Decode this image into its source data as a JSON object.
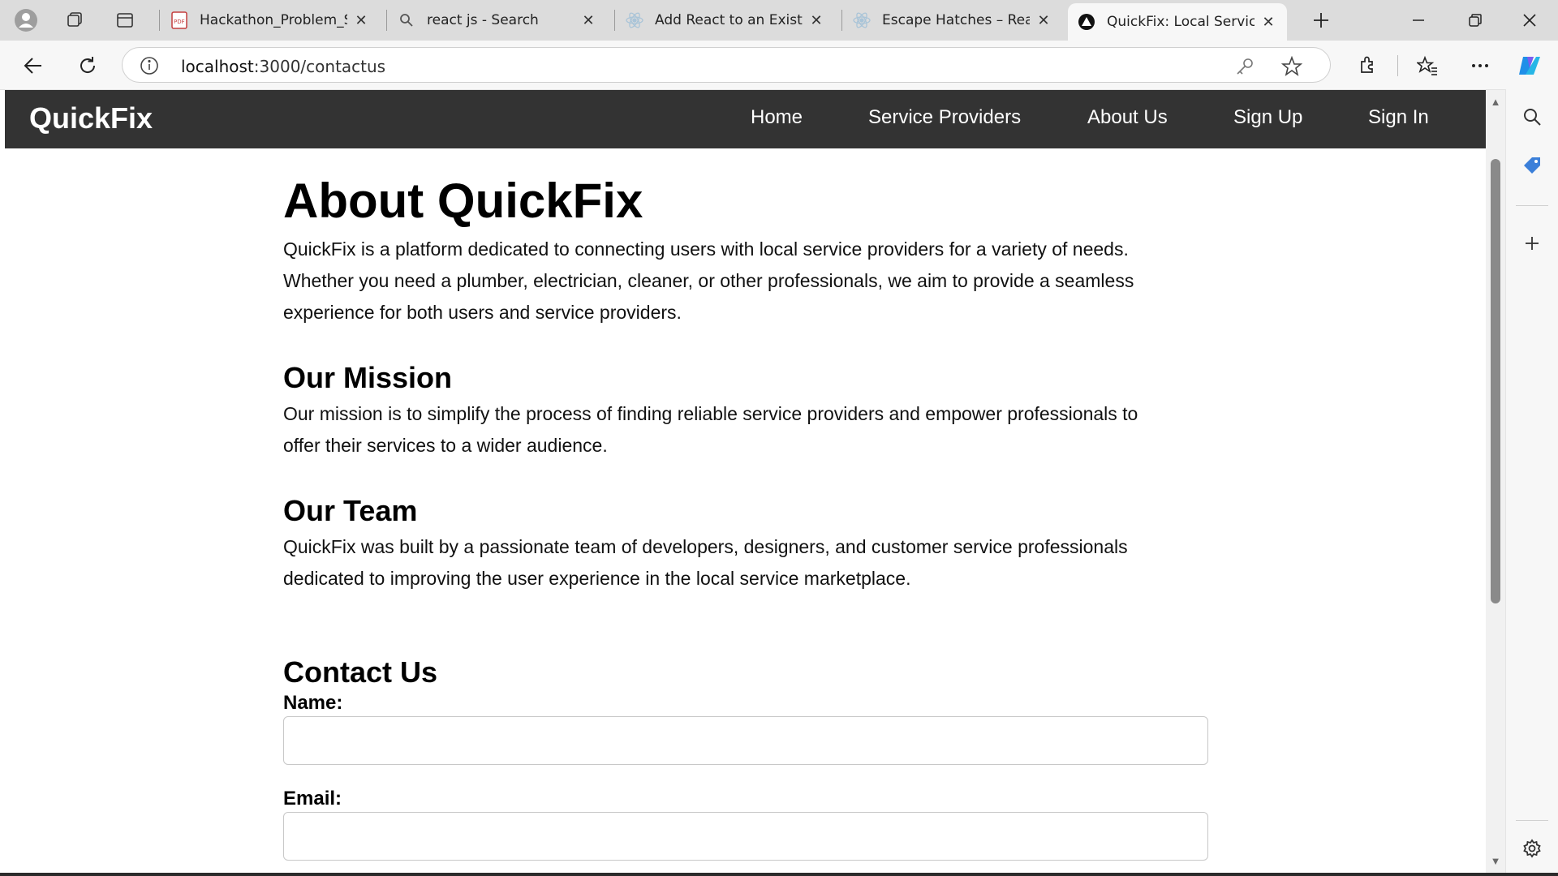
{
  "browser": {
    "tabs": [
      {
        "label": "Hackathon_Problem_Sta",
        "favicon": "pdf-icon"
      },
      {
        "label": "react js - Search",
        "favicon": "search-icon"
      },
      {
        "label": "Add React to an Existing",
        "favicon": "react-icon"
      },
      {
        "label": "Escape Hatches – React",
        "favicon": "react-icon"
      },
      {
        "label": "QuickFix: Local Service P",
        "favicon": "app-icon",
        "active": true
      }
    ],
    "url_host": "localhost",
    "url_rest": ":3000/contactus"
  },
  "app": {
    "brand": "QuickFix",
    "nav": {
      "home": "Home",
      "providers": "Service Providers",
      "about": "About Us",
      "signup": "Sign Up",
      "signin": "Sign In"
    }
  },
  "page": {
    "title": "About QuickFix",
    "intro_line1": "QuickFix is a platform dedicated to connecting users with local service providers for a variety of needs.",
    "intro_line2": "Whether you need a plumber, electrician, cleaner, or other professionals, we aim to provide a seamless",
    "intro_line3": "experience for both users and service providers.",
    "mission_heading": "Our Mission",
    "mission_line1": "Our mission is to simplify the process of finding reliable service providers and empower professionals to",
    "mission_line2": "offer their services to a wider audience.",
    "team_heading": "Our Team",
    "team_line1": "QuickFix was built by a passionate team of developers, designers, and customer service professionals",
    "team_line2": "dedicated to improving the user experience in the local service marketplace.",
    "contact_heading": "Contact Us",
    "name_label": "Name:",
    "name_value": "",
    "email_label": "Email:",
    "email_value": ""
  },
  "colors": {
    "navbar": "#333333",
    "accent": "#0078d4"
  }
}
